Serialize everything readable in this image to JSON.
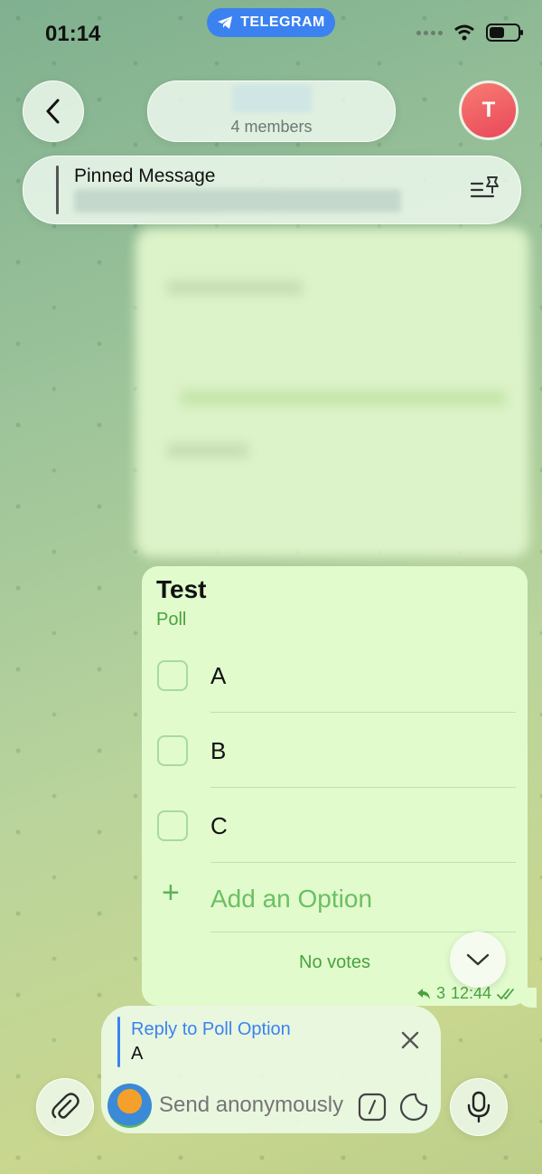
{
  "status_bar": {
    "time": "01:14",
    "app_pill": "TELEGRAM"
  },
  "header": {
    "subtitle": "4 members",
    "avatar_letter": "T"
  },
  "pinned": {
    "title": "Pinned Message"
  },
  "poll": {
    "title": "Test",
    "type": "Poll",
    "options": [
      {
        "label": "A"
      },
      {
        "label": "B"
      },
      {
        "label": "C"
      }
    ],
    "add_option": "Add an Option",
    "votes_text": "No votes",
    "reply_count": "3",
    "time": "12:44"
  },
  "composer": {
    "reply_title": "Reply to Poll Option",
    "reply_text": "A",
    "placeholder": "Send anonymously"
  },
  "colors": {
    "accent_blue": "#3b82f0",
    "bubble_green": "#e1fbcd",
    "poll_green": "#4aa23f"
  }
}
